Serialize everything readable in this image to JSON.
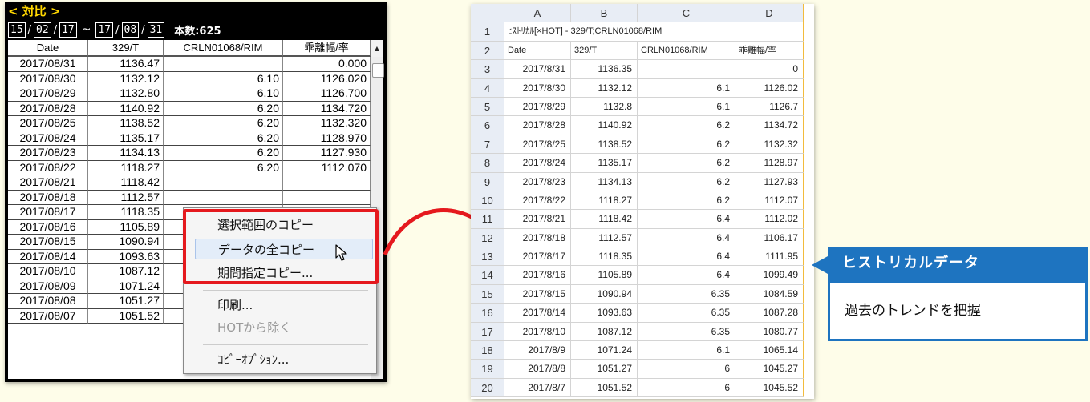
{
  "window": {
    "title": "< 対比 >",
    "range": {
      "from": [
        "15",
        "02",
        "17"
      ],
      "to": [
        "17",
        "08",
        "31"
      ],
      "tilde": "~",
      "slash": "/"
    },
    "count_label": "本数:625"
  },
  "grid": {
    "headers": [
      "Date",
      "329/T",
      "CRLN01068/RIM",
      "乖離幅/率"
    ],
    "rows": [
      [
        "2017/08/31",
        "1136.47",
        "",
        "0.000"
      ],
      [
        "2017/08/30",
        "1132.12",
        "6.10",
        "1126.020"
      ],
      [
        "2017/08/29",
        "1132.80",
        "6.10",
        "1126.700"
      ],
      [
        "2017/08/28",
        "1140.92",
        "6.20",
        "1134.720"
      ],
      [
        "2017/08/25",
        "1138.52",
        "6.20",
        "1132.320"
      ],
      [
        "2017/08/24",
        "1135.17",
        "6.20",
        "1128.970"
      ],
      [
        "2017/08/23",
        "1134.13",
        "6.20",
        "1127.930"
      ],
      [
        "2017/08/22",
        "1118.27",
        "6.20",
        "1112.070"
      ],
      [
        "2017/08/21",
        "1118.42",
        "",
        ""
      ],
      [
        "2017/08/18",
        "1112.57",
        "",
        ""
      ],
      [
        "2017/08/17",
        "1118.35",
        "",
        ""
      ],
      [
        "2017/08/16",
        "1105.89",
        "",
        ""
      ],
      [
        "2017/08/15",
        "1090.94",
        "",
        ""
      ],
      [
        "2017/08/14",
        "1093.63",
        "",
        ""
      ],
      [
        "2017/08/10",
        "1087.12",
        "",
        ""
      ],
      [
        "2017/08/09",
        "1071.24",
        "",
        ""
      ],
      [
        "2017/08/08",
        "1051.27",
        "",
        ""
      ],
      [
        "2017/08/07",
        "1051.52",
        "",
        ""
      ]
    ]
  },
  "context_menu": {
    "items": [
      {
        "label": "選択範囲のコピー",
        "state": "normal"
      },
      {
        "label": "データの全コピー",
        "state": "highlighted"
      },
      {
        "label": "期間指定コピー...",
        "state": "normal"
      },
      {
        "label": "印刷...",
        "state": "normal"
      },
      {
        "label": "HOTから除く",
        "state": "disabled"
      },
      {
        "label": "ｺﾋﾟｰｵﾌﾟｼｮﾝ...",
        "state": "normal"
      }
    ]
  },
  "sheet": {
    "columns": [
      "A",
      "B",
      "C",
      "D"
    ],
    "title_row": "ﾋｽﾄﾘｶﾙ[×HOT] - 329/T;CRLN01068/RIM",
    "header_row": [
      "Date",
      "329/T",
      "CRLN01068/RIM",
      "乖離幅/率"
    ],
    "rows": [
      [
        "2017/8/31",
        "1136.35",
        "",
        "0"
      ],
      [
        "2017/8/30",
        "1132.12",
        "6.1",
        "1126.02"
      ],
      [
        "2017/8/29",
        "1132.8",
        "6.1",
        "1126.7"
      ],
      [
        "2017/8/28",
        "1140.92",
        "6.2",
        "1134.72"
      ],
      [
        "2017/8/25",
        "1138.52",
        "6.2",
        "1132.32"
      ],
      [
        "2017/8/24",
        "1135.17",
        "6.2",
        "1128.97"
      ],
      [
        "2017/8/23",
        "1134.13",
        "6.2",
        "1127.93"
      ],
      [
        "2017/8/22",
        "1118.27",
        "6.2",
        "1112.07"
      ],
      [
        "2017/8/21",
        "1118.42",
        "6.4",
        "1112.02"
      ],
      [
        "2017/8/18",
        "1112.57",
        "6.4",
        "1106.17"
      ],
      [
        "2017/8/17",
        "1118.35",
        "6.4",
        "1111.95"
      ],
      [
        "2017/8/16",
        "1105.89",
        "6.4",
        "1099.49"
      ],
      [
        "2017/8/15",
        "1090.94",
        "6.35",
        "1084.59"
      ],
      [
        "2017/8/14",
        "1093.63",
        "6.35",
        "1087.28"
      ],
      [
        "2017/8/10",
        "1087.12",
        "6.35",
        "1080.77"
      ],
      [
        "2017/8/9",
        "1071.24",
        "6.1",
        "1065.14"
      ],
      [
        "2017/8/8",
        "1051.27",
        "6",
        "1045.27"
      ],
      [
        "2017/8/7",
        "1051.52",
        "6",
        "1045.52"
      ]
    ]
  },
  "callout": {
    "title": "ヒストリカルデータ",
    "body": "過去のトレンドを把握"
  },
  "colors": {
    "highlight_red": "#e5191e",
    "callout_blue": "#1e74c0",
    "window_title": "#ffd700",
    "background": "#fefde9"
  }
}
